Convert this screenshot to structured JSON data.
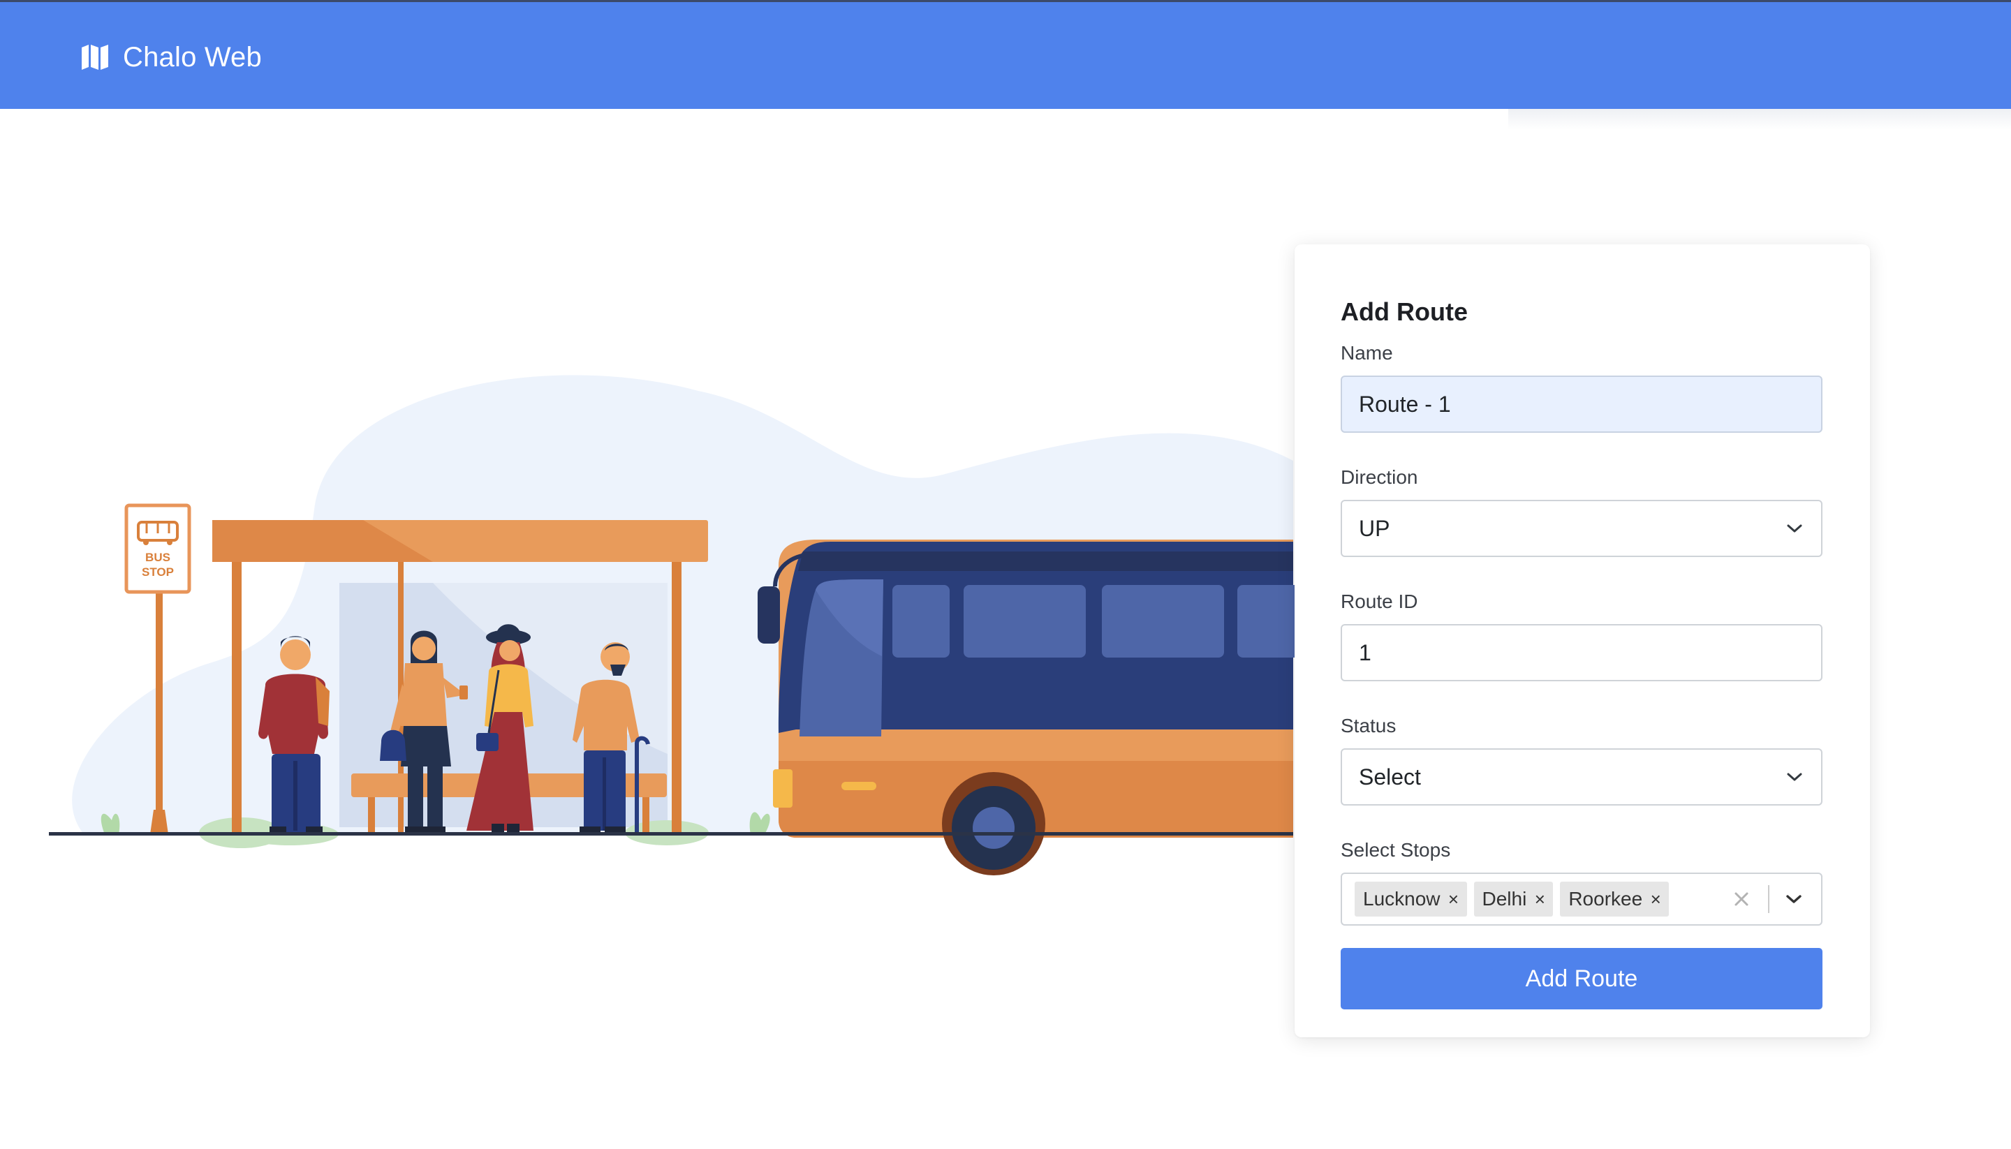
{
  "app": {
    "name": "Chalo Web",
    "brand_color": "#4f82ec"
  },
  "illustration": {
    "sign_line1": "BUS",
    "sign_line2": "STOP"
  },
  "form": {
    "title": "Add Route",
    "name": {
      "label": "Name",
      "value": "Route - 1"
    },
    "direction": {
      "label": "Direction",
      "value": "UP"
    },
    "route_id": {
      "label": "Route ID",
      "value": "1"
    },
    "status": {
      "label": "Status",
      "value": "Select"
    },
    "stops": {
      "label": "Select Stops",
      "selected": [
        {
          "label": "Lucknow"
        },
        {
          "label": "Delhi"
        },
        {
          "label": "Roorkee"
        }
      ]
    },
    "submit_label": "Add Route"
  },
  "icons": {
    "brand": "map-icon",
    "chevron": "chevron-down-icon",
    "clear": "close-icon"
  }
}
